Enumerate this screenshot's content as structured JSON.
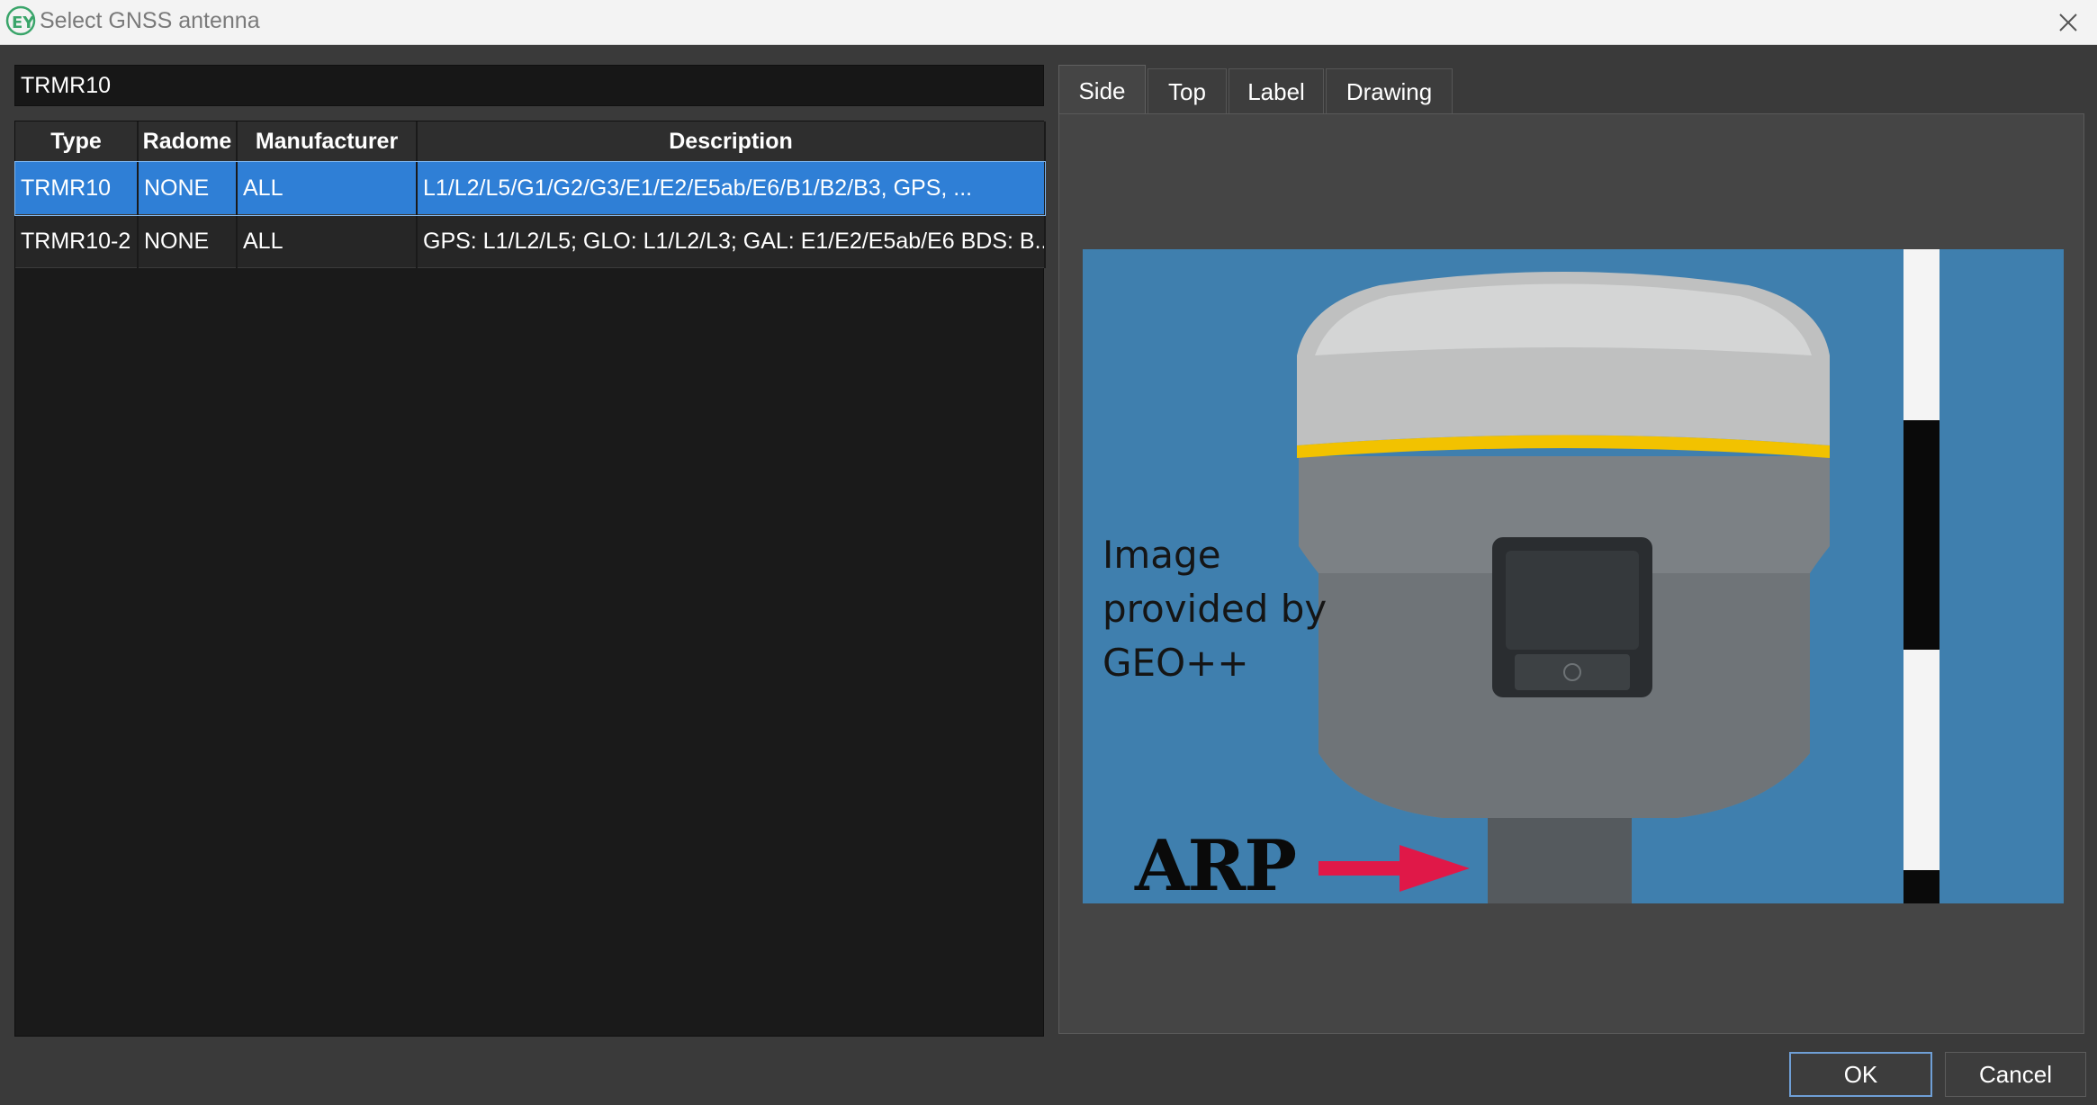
{
  "window": {
    "title": "Select GNSS antenna",
    "app_icon": "ey-logo-icon",
    "close_icon": "close-icon"
  },
  "search": {
    "value": "TRMR10"
  },
  "table": {
    "columns": [
      "Type",
      "Radome",
      "Manufacturer",
      "Description"
    ],
    "rows": [
      {
        "type": "TRMR10",
        "radome": "NONE",
        "manufacturer": "ALL",
        "description": "L1/L2/L5/G1/G2/G3/E1/E2/E5ab/E6/B1/B2/B3, GPS, ...",
        "selected": true
      },
      {
        "type": "TRMR10-2",
        "radome": "NONE",
        "manufacturer": "ALL",
        "description": "GPS: L1/L2/L5; GLO: L1/L2/L3; GAL: E1/E2/E5ab/E6 BDS: B...",
        "selected": false
      }
    ]
  },
  "tabs": [
    "Side",
    "Top",
    "Label",
    "Drawing"
  ],
  "active_tab": "Side",
  "antenna_image": {
    "caption": "Image\nprovided by\nGEO++",
    "arp_label": "ARP",
    "colors": {
      "background": "#3f7fae",
      "stripe": "#f2c200",
      "arrow": "#e01848"
    }
  },
  "buttons": {
    "ok": "OK",
    "cancel": "Cancel"
  },
  "colors": {
    "selection": "#2f7fd6",
    "dialog_bg": "#3a3a3a"
  }
}
